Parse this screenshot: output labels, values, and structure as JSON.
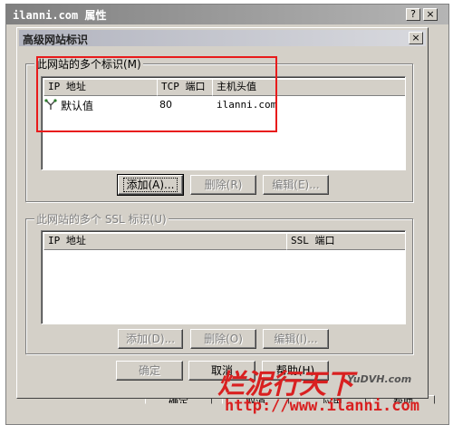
{
  "outer_window": {
    "title": "ilanni.com 属性",
    "bottom_buttons": [
      "确定",
      "取消",
      "应用",
      "帮助"
    ]
  },
  "dialog": {
    "title": "高级网站标识",
    "close_glyph": "×",
    "identities_group": {
      "label": "此网站的多个标识(M)",
      "columns": [
        "IP 地址",
        "TCP 端口",
        "主机头值"
      ],
      "rows": [
        {
          "ip": "默认值",
          "port": "80",
          "host": "ilanni.com"
        }
      ],
      "buttons": {
        "add": "添加(A)...",
        "remove": "删除(R)",
        "edit": "编辑(E)..."
      }
    },
    "ssl_group": {
      "label": "此网站的多个 SSL 标识(U)",
      "columns": [
        "IP 地址",
        "SSL 端口"
      ],
      "buttons": {
        "add": "添加(D)...",
        "remove": "删除(O)",
        "edit": "编辑(I)..."
      }
    },
    "footer_buttons": {
      "ok": "确定",
      "cancel": "取消",
      "help": "帮助(H)"
    }
  },
  "outer_titlebar_buttons": {
    "help": "?",
    "close": "×"
  },
  "watermark": {
    "logo_text": "烂泥行天下",
    "url": "http://www.ilanni.com",
    "site": "YuDVH.com"
  },
  "colors": {
    "annotation_red": "#e81b1b",
    "dialog_bg": "#d4d0c8"
  }
}
